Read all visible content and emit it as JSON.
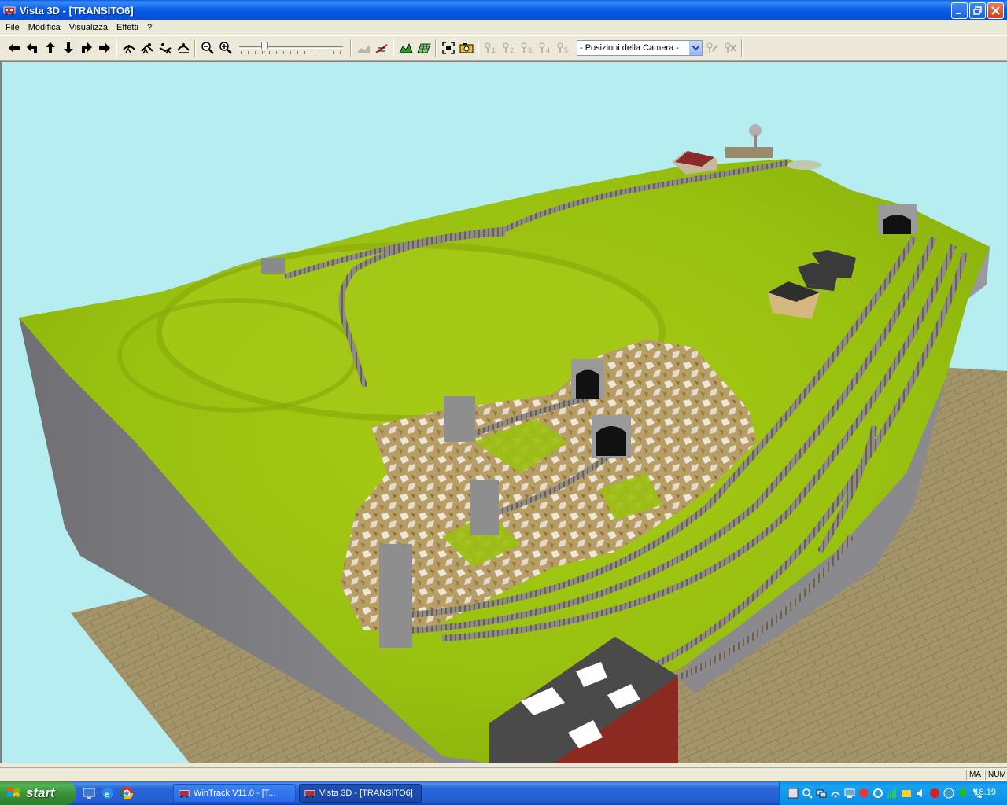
{
  "window": {
    "title": "Vista 3D - [TRANSITO6]",
    "controls": {
      "minimize": "minimize",
      "restore": "restore",
      "close": "close"
    }
  },
  "menu": {
    "items": [
      "File",
      "Modifica",
      "Visualizza",
      "Effetti",
      "?"
    ]
  },
  "toolbar": {
    "nav_icons": [
      "arrow-left-icon",
      "turn-left-icon",
      "arrow-up-icon",
      "arrow-down-icon",
      "turn-right-icon",
      "arrow-right-icon"
    ],
    "view_icons": [
      "walker-icon-1",
      "walker-icon-2",
      "walker-icon-3",
      "walker-icon-4"
    ],
    "zoom_icons": [
      "zoom-out-icon",
      "zoom-in-icon"
    ],
    "slider_level": 0.23,
    "camera_slots": [
      "1",
      "2",
      "3",
      "4",
      "5"
    ],
    "camera_select": {
      "value": "- Posizioni della Camera -"
    }
  },
  "statusbar": {
    "caps": "MA",
    "num": "NUM"
  },
  "taskbar": {
    "start_label": "start",
    "tasks": [
      {
        "label": "WinTrack  V11.0 - [T...",
        "active": false
      },
      {
        "label": "Vista 3D - [TRANSITO6]",
        "active": true
      }
    ],
    "clock": "18.19"
  },
  "colors": {
    "sky": "#b5edf1",
    "grass": "#9ac20e",
    "base_side": "#7f7f83",
    "floor": "#a0926a",
    "title_bar": "#0a5ee8"
  }
}
